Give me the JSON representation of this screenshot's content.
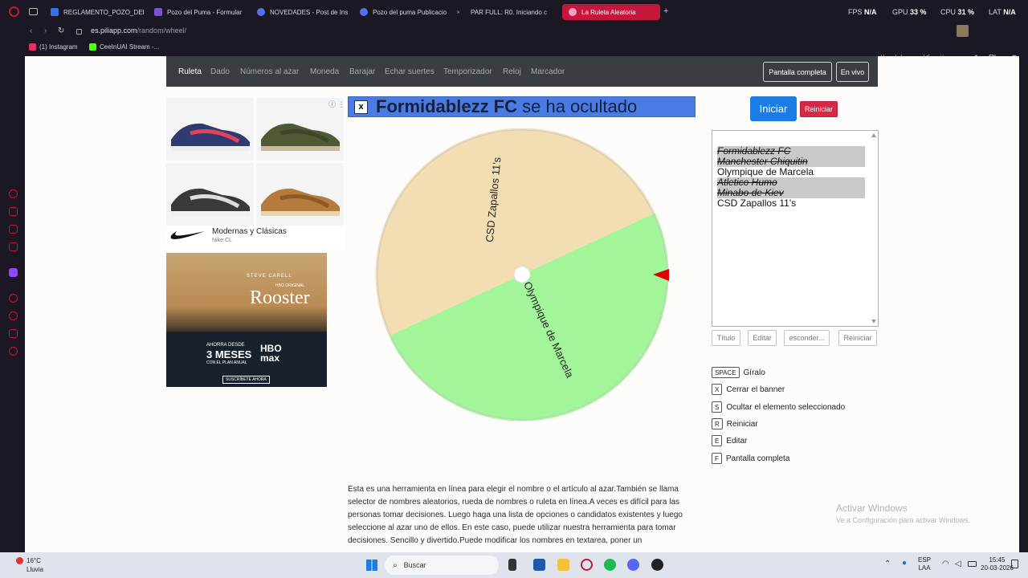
{
  "browser": {
    "tabs": [
      {
        "title": "REGLAMENTO_POZO_DEL",
        "color": "#3b6ee6"
      },
      {
        "title": "Pozo del Puma - Formular",
        "color": "#7b4fd6"
      },
      {
        "title": "NOVEDADES - Post de Ins",
        "color": "#5b6ef0"
      },
      {
        "title": "Pozo del puma Publicacio",
        "color": "#5b6ef0"
      },
      {
        "title": "PAR FULL: R0. Iniciando c",
        "color": "#2a2a2a"
      },
      {
        "title": "La Ruleta Aleatoria",
        "color": "#f2a2c0"
      }
    ],
    "new_tab": "+",
    "stats": {
      "fps_label": "FPS",
      "fps_value": "N/A",
      "gpu_label": "GPU",
      "gpu_value": "33 %",
      "cpu_label": "CPU",
      "cpu_value": "31 %",
      "lat_label": "LAT",
      "lat_value": "N/A"
    },
    "url_prefix": "es.",
    "url_domain": "piliapp.com",
    "url_path": "/random/wheel/",
    "bookmarks": [
      "(1) Instagram",
      "CeeInUAI Stream -..."
    ]
  },
  "nav": {
    "items": [
      "Ruleta",
      "Dado",
      "Números al azar",
      "Moneda",
      "Barajar",
      "Echar suertes",
      "Temporizador",
      "Reloj",
      "Marcador"
    ],
    "fullscreen": "Pantalla completa",
    "live": "En vivo"
  },
  "ads": {
    "brand": "Modernas y Clásicas",
    "brand_sub": "Nike CL",
    "hbo_top": "STEVE CARELL",
    "hbo_network": "HBO ORIGINAL",
    "hbo_title": "Rooster",
    "hbo_offer_1": "AHORRA DESDE",
    "hbo_offer_2": "3 MESES",
    "hbo_offer_3": "CON EL PLAN ANUAL",
    "hbo_logo": "HBO max",
    "hbo_cta": "SUSCRÍBETE AHORA"
  },
  "banner": {
    "close": "x",
    "name": "Formidablezz FC",
    "suffix": " se ha ocultado"
  },
  "wheel": {
    "segments": [
      {
        "label": "CSD Zapallos 11's",
        "color": "#f3deb3"
      },
      {
        "label": "Olympique de Marcela",
        "color": "#a2f598"
      }
    ],
    "pointer_color": "#e00000"
  },
  "controls": {
    "start": "Iniciar",
    "reset": "Reiniciar"
  },
  "entries": [
    {
      "text": "Formidablezz FC",
      "hidden": true
    },
    {
      "text": "Manchester Chiquitin",
      "hidden": true
    },
    {
      "text": "Olympique de Marcela",
      "hidden": false
    },
    {
      "text": "Atletico Humo",
      "hidden": true
    },
    {
      "text": "Minabo de Kiev",
      "hidden": true
    },
    {
      "text": "CSD Zapallos 11's",
      "hidden": false
    }
  ],
  "list_buttons": [
    "Título",
    "Editar",
    "esconder...",
    "Reiniciar"
  ],
  "shortcuts": [
    {
      "key": "SPACE",
      "label": "Gíralo"
    },
    {
      "key": "X",
      "label": "Cerrar el banner"
    },
    {
      "key": "S",
      "label": "Ocultar el elemento seleccionado"
    },
    {
      "key": "R",
      "label": "Reiniciar"
    },
    {
      "key": "E",
      "label": "Editar"
    },
    {
      "key": "F",
      "label": "Pantalla completa"
    }
  ],
  "description": "Esta es una herramienta en línea para elegir el nombre o el artículo al azar.También se llama selector de nombres aleatorios, rueda de nombres o ruleta en línea.A veces es difícil para las personas tomar decisiones. Luego haga una lista de opciones o candidatos existentes y luego seleccione al azar uno de ellos. En este caso, puede utilizar nuestra herramienta para tomar decisiones. Sencillo y divertido.Puede modificar los nombres en textarea, poner un",
  "windows_watermark": {
    "line1": "Activar Windows",
    "line2": "Ve a Configuración para activar Windows."
  },
  "taskbar": {
    "temp": "16°C",
    "weather": "Lluvia",
    "search_placeholder": "Buscar",
    "lang1": "ESP",
    "lang2": "LAA",
    "time": "15:45",
    "date": "20-03-2026"
  }
}
